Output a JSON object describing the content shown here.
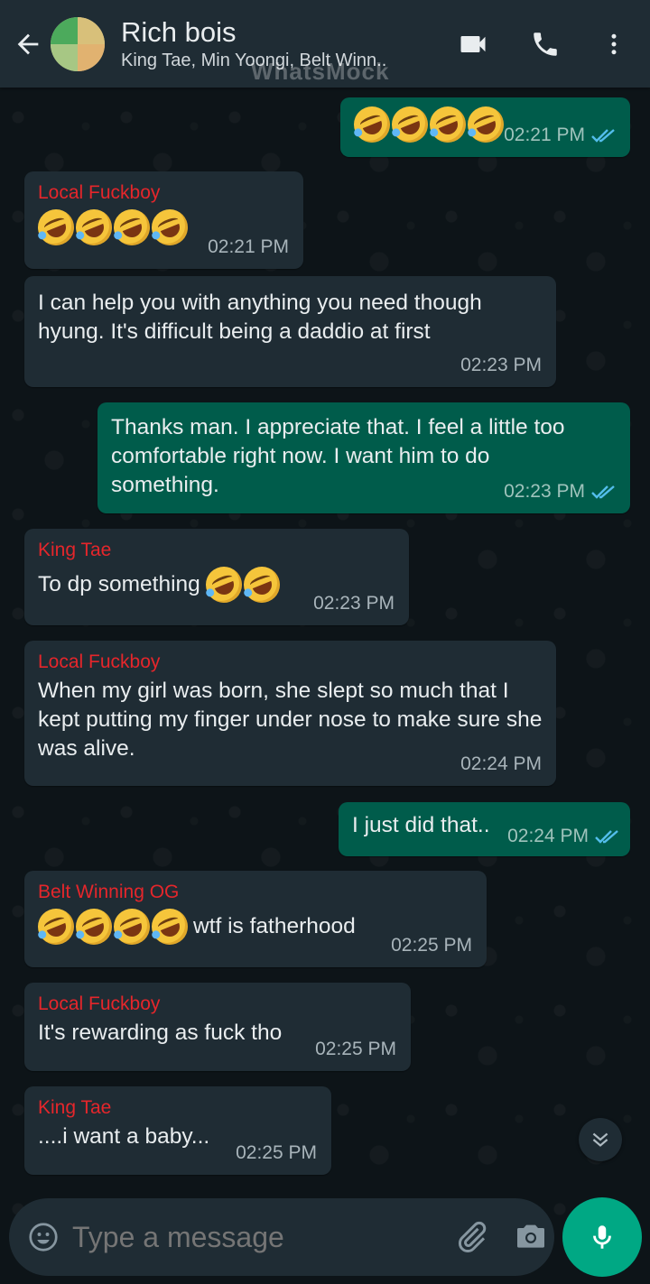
{
  "header": {
    "title": "Rich bois",
    "subtitle": "King Tae, Min Yoongi, Belt Winn..",
    "watermark": "WhatsMock",
    "icons": [
      "back-arrow-icon",
      "video-call-icon",
      "phone-call-icon",
      "more-options-icon"
    ]
  },
  "messages": [
    {
      "direction": "out",
      "emoji_count": 4,
      "text": "",
      "time": "02:21 PM",
      "status": "read"
    },
    {
      "direction": "in",
      "sender": "Local Fuckboy",
      "emoji_count": 4,
      "text": "",
      "time": "02:21 PM"
    },
    {
      "direction": "in",
      "sender": "",
      "text": "I can help you with anything you need though hyung. It's difficult being a daddio at first",
      "time": "02:23 PM"
    },
    {
      "direction": "out",
      "text": "Thanks man. I appreciate that. I feel a little too comfortable right now. I want him to do something.",
      "time": "02:23 PM",
      "status": "read"
    },
    {
      "direction": "in",
      "sender": "King Tae",
      "text": "To dp something",
      "emoji_count": 2,
      "time": "02:23 PM"
    },
    {
      "direction": "in",
      "sender": "Local Fuckboy",
      "text": "When my girl was born, she slept so much that I kept putting my finger under nose to make sure she was alive.",
      "time": "02:24 PM"
    },
    {
      "direction": "out",
      "text": "I just did that..",
      "time": "02:24 PM",
      "status": "read"
    },
    {
      "direction": "in",
      "sender": "Belt Winning OG",
      "emoji_count": 4,
      "text": "wtf is fatherhood",
      "time": "02:25 PM"
    },
    {
      "direction": "in",
      "sender": "Local Fuckboy",
      "text": "It's rewarding as fuck tho",
      "time": "02:25 PM"
    },
    {
      "direction": "in",
      "sender": "King Tae",
      "text": "....i want a baby...",
      "time": "02:25 PM"
    }
  ],
  "composer": {
    "placeholder": "Type a message",
    "icons": [
      "emoji-icon",
      "attach-icon",
      "camera-icon",
      "mic-icon"
    ]
  },
  "colors": {
    "header_bg": "#1f2c34",
    "incoming_bubble": "#1f2c34",
    "outgoing_bubble": "#005c4b",
    "sender_name": "#e5262b",
    "read_tick": "#53bdeb",
    "mic_button": "#00a884"
  }
}
